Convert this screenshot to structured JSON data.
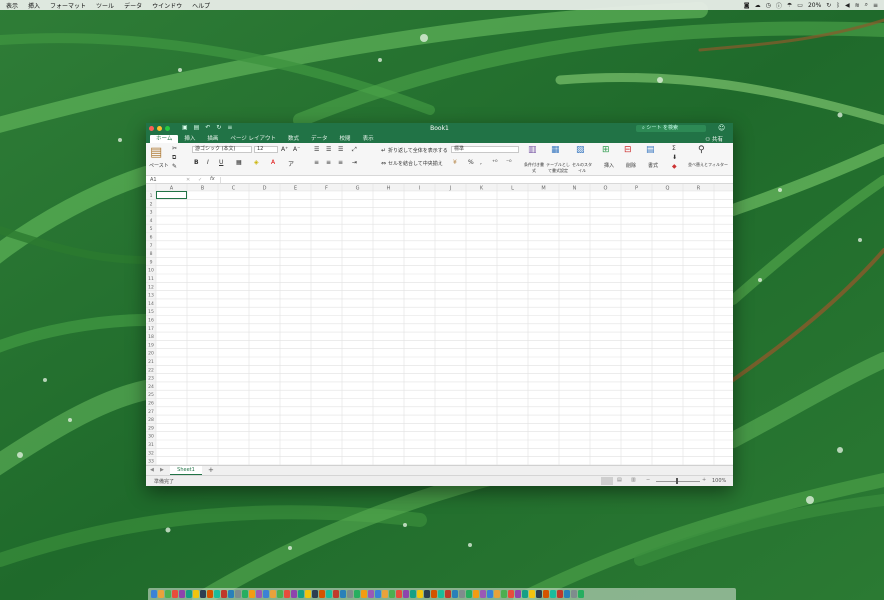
{
  "menubar": {
    "items": [
      "表示",
      "挿入",
      "フォーマット",
      "ツール",
      "データ",
      "ウインドウ",
      "ヘルプ"
    ],
    "battery": "20%"
  },
  "window": {
    "title": "Book1",
    "search_placeholder": "シート を検索",
    "tabs": [
      "ホーム",
      "挿入",
      "描画",
      "ページ レイアウト",
      "数式",
      "データ",
      "校閲",
      "表示"
    ],
    "share_label": "共有"
  },
  "ribbon": {
    "paste_label": "ペースト",
    "font_name": "游ゴシック (本文)",
    "font_size": "12",
    "wrap_text_label": "折り返して全体を表示する",
    "merge_label": "セルを結合して中央揃え",
    "number_format": "標準",
    "conditional_format_label": "条件付き書式",
    "format_as_table_label": "テーブルとして書式設定",
    "cell_styles_label": "セルのスタイル",
    "insert_label": "挿入",
    "delete_label": "削除",
    "format_label": "書式",
    "sort_filter_label": "並べ替えとフィルター",
    "bold": "B",
    "italic": "I",
    "underline": "U"
  },
  "formula_bar": {
    "cell_ref": "A1",
    "fx": "fx"
  },
  "grid": {
    "columns": [
      "A",
      "B",
      "C",
      "D",
      "E",
      "F",
      "G",
      "H",
      "I",
      "J",
      "K",
      "L",
      "M",
      "N",
      "O",
      "P",
      "Q",
      "R"
    ],
    "row_count": 33
  },
  "sheet_tabs": {
    "active": "Sheet1",
    "add": "+"
  },
  "status": {
    "text": "準備完了",
    "zoom": "100%"
  },
  "colors": {
    "excel_green": "#217346",
    "wallpaper_dark": "#1c5c26",
    "wallpaper_light": "#4fa352"
  }
}
